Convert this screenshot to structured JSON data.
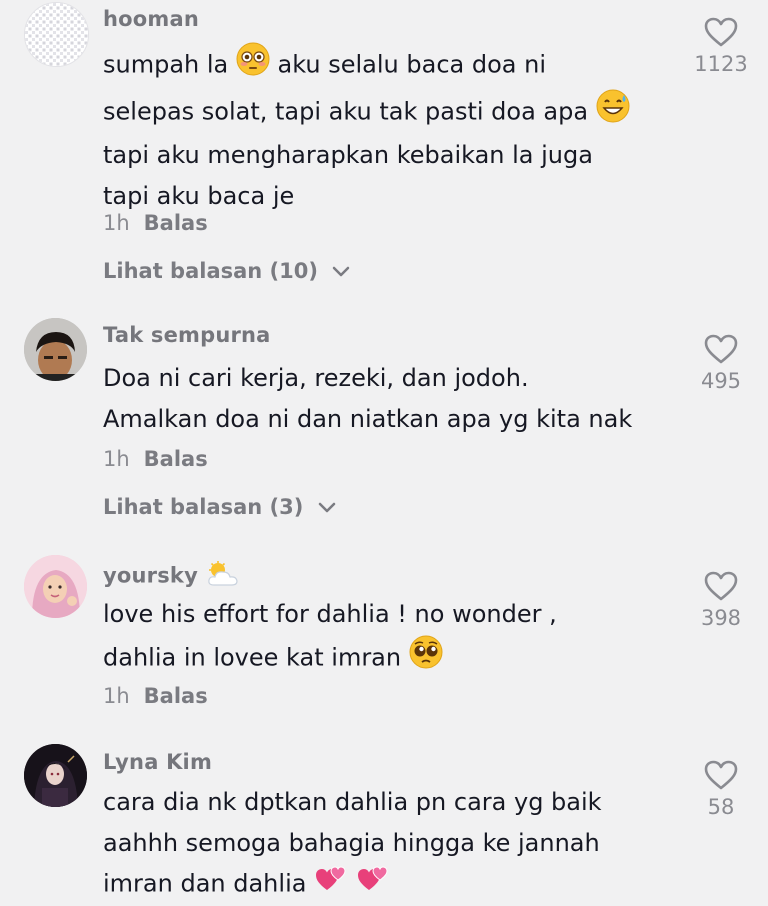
{
  "comments": [
    {
      "username": "hooman",
      "lines": [
        "sumpah la",
        "aku selalu baca doa ni",
        "selepas solat, tapi aku tak pasti doa apa",
        "tapi aku mengharapkan kebaikan la juga",
        "tapi aku baca je"
      ],
      "emojis": [
        "flushed-face-emoji",
        "grinning-sweat-face-emoji"
      ],
      "time": "1h",
      "reply_label": "Balas",
      "view_replies": "Lihat balasan (10)",
      "likes": "1123"
    },
    {
      "username": "Tak sempurna",
      "lines": [
        "Doa ni cari kerja, rezeki, dan jodoh.",
        "Amalkan doa ni dan niatkan apa yg kita nak"
      ],
      "time": "1h",
      "reply_label": "Balas",
      "view_replies": "Lihat balasan (3)",
      "likes": "495"
    },
    {
      "username": "yoursky",
      "badge": "sun-behind-cloud-emoji",
      "lines": [
        "love his effort for dahlia ! no wonder ,",
        "dahlia in lovee kat imran"
      ],
      "emojis": [
        "pleading-face-emoji"
      ],
      "time": "1h",
      "reply_label": "Balas",
      "likes": "398"
    },
    {
      "username": "Lyna Kim",
      "lines": [
        "cara dia nk dptkan dahlia pn cara yg baik",
        "aahhh semoga bahagia hingga ke jannah",
        "imran dan dahlia"
      ],
      "emojis": [
        "two-hearts-emoji",
        "two-hearts-emoji"
      ],
      "likes": "58"
    }
  ],
  "colors": {
    "background": "#f1f1f2",
    "text": "#161823",
    "muted": "#8a8b91"
  }
}
